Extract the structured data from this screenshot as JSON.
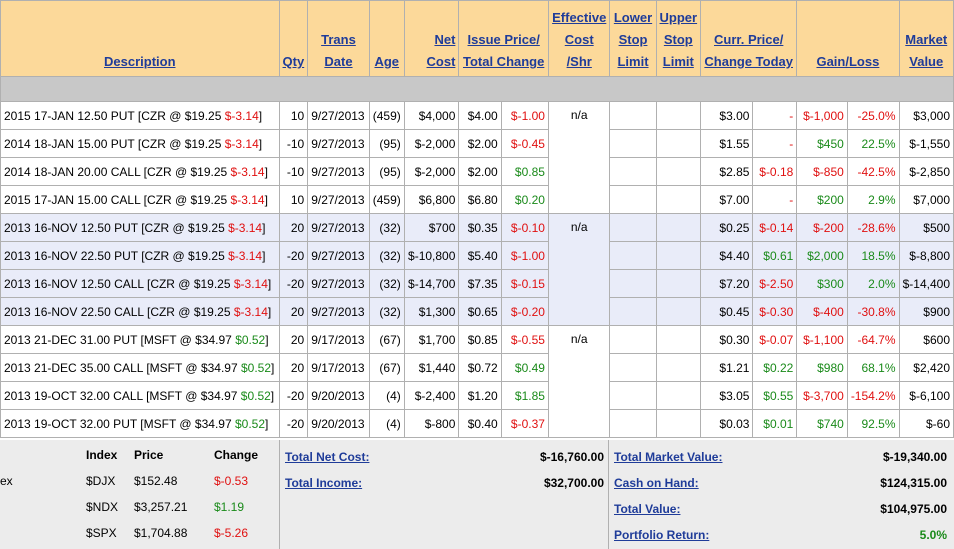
{
  "columns": {
    "description": "Description",
    "qty": "Qty",
    "trans_date": [
      "Trans",
      "Date"
    ],
    "age": "Age",
    "net_cost": [
      "Net",
      "Cost"
    ],
    "issue_price": [
      "Issue Price/",
      "Total Change"
    ],
    "effective_cost": [
      "Effective",
      "Cost",
      "/Shr"
    ],
    "lower_stop": [
      "Lower",
      "Stop",
      "Limit"
    ],
    "upper_stop": [
      "Upper",
      "Stop",
      "Limit"
    ],
    "curr_price": [
      "Curr. Price/",
      "Change Today"
    ],
    "gain_loss": "Gain/Loss",
    "market_value": [
      "Market",
      "Value"
    ]
  },
  "rows": [
    {
      "desc": "2015 17-JAN 12.50 PUT [CZR @ $19.25 ",
      "desc_chg": "$-3.14",
      "desc_end": "]",
      "qty": "10",
      "date": "9/27/2013",
      "age": "(459)",
      "net": "$4,000",
      "issue": "$4.00",
      "tchg": "$-1.00",
      "tchg_s": "neg",
      "eff": "n/a",
      "curr": "$3.00",
      "today": "-",
      "today_s": "neg",
      "gl": "$-1,000",
      "gl_s": "neg",
      "glp": "-25.0%",
      "glp_s": "neg",
      "mv": "$3,000",
      "alt": false
    },
    {
      "desc": "2014 18-JAN 15.00 PUT [CZR @ $19.25 ",
      "desc_chg": "$-3.14",
      "desc_end": "]",
      "qty": "-10",
      "date": "9/27/2013",
      "age": "(95)",
      "net": "$-2,000",
      "issue": "$2.00",
      "tchg": "$-0.45",
      "tchg_s": "neg",
      "eff": "",
      "curr": "$1.55",
      "today": "-",
      "today_s": "neg",
      "gl": "$450",
      "gl_s": "pos",
      "glp": "22.5%",
      "glp_s": "pos",
      "mv": "$-1,550",
      "alt": false
    },
    {
      "desc": "2014 18-JAN 20.00 CALL [CZR @ $19.25 ",
      "desc_chg": "$-3.14",
      "desc_end": "]",
      "qty": "-10",
      "date": "9/27/2013",
      "age": "(95)",
      "net": "$-2,000",
      "issue": "$2.00",
      "tchg": "$0.85",
      "tchg_s": "pos",
      "eff": "",
      "curr": "$2.85",
      "today": "$-0.18",
      "today_s": "neg",
      "gl": "$-850",
      "gl_s": "neg",
      "glp": "-42.5%",
      "glp_s": "neg",
      "mv": "$-2,850",
      "alt": false
    },
    {
      "desc": "2015 17-JAN 15.00 CALL [CZR @ $19.25 ",
      "desc_chg": "$-3.14",
      "desc_end": "]",
      "qty": "10",
      "date": "9/27/2013",
      "age": "(459)",
      "net": "$6,800",
      "issue": "$6.80",
      "tchg": "$0.20",
      "tchg_s": "pos",
      "eff": "",
      "curr": "$7.00",
      "today": "-",
      "today_s": "neg",
      "gl": "$200",
      "gl_s": "pos",
      "glp": "2.9%",
      "glp_s": "pos",
      "mv": "$7,000",
      "alt": false
    },
    {
      "desc": "2013 16-NOV 12.50 PUT [CZR @ $19.25 ",
      "desc_chg": "$-3.14",
      "desc_end": "]",
      "qty": "20",
      "date": "9/27/2013",
      "age": "(32)",
      "net": "$700",
      "issue": "$0.35",
      "tchg": "$-0.10",
      "tchg_s": "neg",
      "eff": "n/a",
      "curr": "$0.25",
      "today": "$-0.14",
      "today_s": "neg",
      "gl": "$-200",
      "gl_s": "neg",
      "glp": "-28.6%",
      "glp_s": "neg",
      "mv": "$500",
      "alt": true
    },
    {
      "desc": "2013 16-NOV 22.50 PUT [CZR @ $19.25 ",
      "desc_chg": "$-3.14",
      "desc_end": "]",
      "qty": "-20",
      "date": "9/27/2013",
      "age": "(32)",
      "net": "$-10,800",
      "issue": "$5.40",
      "tchg": "$-1.00",
      "tchg_s": "neg",
      "eff": "",
      "curr": "$4.40",
      "today": "$0.61",
      "today_s": "pos",
      "gl": "$2,000",
      "gl_s": "pos",
      "glp": "18.5%",
      "glp_s": "pos",
      "mv": "$-8,800",
      "alt": true
    },
    {
      "desc": "2013 16-NOV 12.50 CALL [CZR @ $19.25 ",
      "desc_chg": "$-3.14",
      "desc_end": "]",
      "qty": "-20",
      "date": "9/27/2013",
      "age": "(32)",
      "net": "$-14,700",
      "issue": "$7.35",
      "tchg": "$-0.15",
      "tchg_s": "neg",
      "eff": "",
      "curr": "$7.20",
      "today": "$-2.50",
      "today_s": "neg",
      "gl": "$300",
      "gl_s": "pos",
      "glp": "2.0%",
      "glp_s": "pos",
      "mv": "$-14,400",
      "alt": true
    },
    {
      "desc": "2013 16-NOV 22.50 CALL [CZR @ $19.25 ",
      "desc_chg": "$-3.14",
      "desc_end": "]",
      "qty": "20",
      "date": "9/27/2013",
      "age": "(32)",
      "net": "$1,300",
      "issue": "$0.65",
      "tchg": "$-0.20",
      "tchg_s": "neg",
      "eff": "",
      "curr": "$0.45",
      "today": "$-0.30",
      "today_s": "neg",
      "gl": "$-400",
      "gl_s": "neg",
      "glp": "-30.8%",
      "glp_s": "neg",
      "mv": "$900",
      "alt": true
    },
    {
      "desc": "2013 21-DEC 31.00 PUT [MSFT @ $34.97 ",
      "desc_chg": "$0.52",
      "desc_end": "]",
      "qty": "20",
      "date": "9/17/2013",
      "age": "(67)",
      "net": "$1,700",
      "issue": "$0.85",
      "tchg": "$-0.55",
      "tchg_s": "neg",
      "eff": "n/a",
      "curr": "$0.30",
      "today": "$-0.07",
      "today_s": "neg",
      "gl": "$-1,100",
      "gl_s": "neg",
      "glp": "-64.7%",
      "glp_s": "neg",
      "mv": "$600",
      "alt": false
    },
    {
      "desc": "2013 21-DEC 35.00 CALL [MSFT @ $34.97 ",
      "desc_chg": "$0.52",
      "desc_end": "]",
      "qty": "20",
      "date": "9/17/2013",
      "age": "(67)",
      "net": "$1,440",
      "issue": "$0.72",
      "tchg": "$0.49",
      "tchg_s": "pos",
      "eff": "",
      "curr": "$1.21",
      "today": "$0.22",
      "today_s": "pos",
      "gl": "$980",
      "gl_s": "pos",
      "glp": "68.1%",
      "glp_s": "pos",
      "mv": "$2,420",
      "alt": false
    },
    {
      "desc": "2013 19-OCT 32.00 CALL [MSFT @ $34.97 ",
      "desc_chg": "$0.52",
      "desc_end": "]",
      "qty": "-20",
      "date": "9/20/2013",
      "age": "(4)",
      "net": "$-2,400",
      "issue": "$1.20",
      "tchg": "$1.85",
      "tchg_s": "pos",
      "eff": "",
      "curr": "$3.05",
      "today": "$0.55",
      "today_s": "pos",
      "gl": "$-3,700",
      "gl_s": "neg",
      "glp": "-154.2%",
      "glp_s": "neg",
      "mv": "$-6,100",
      "alt": false
    },
    {
      "desc": "2013 19-OCT 32.00 PUT [MSFT @ $34.97 ",
      "desc_chg": "$0.52",
      "desc_end": "]",
      "qty": "-20",
      "date": "9/20/2013",
      "age": "(4)",
      "net": "$-800",
      "issue": "$0.40",
      "tchg": "$-0.37",
      "tchg_s": "neg",
      "eff": "",
      "curr": "$0.03",
      "today": "$0.01",
      "today_s": "pos",
      "gl": "$740",
      "gl_s": "pos",
      "glp": "92.5%",
      "glp_s": "pos",
      "mv": "$-60",
      "alt": false
    }
  ],
  "index": {
    "cut_label": "ex",
    "headers": {
      "index": "Index",
      "price": "Price",
      "change": "Change"
    },
    "items": [
      {
        "name": "$DJX",
        "price": "$152.48",
        "change": "$-0.53",
        "s": "neg"
      },
      {
        "name": "$NDX",
        "price": "$3,257.21",
        "change": "$1.19",
        "s": "pos"
      },
      {
        "name": "$SPX",
        "price": "$1,704.88",
        "change": "$-5.26",
        "s": "neg"
      }
    ]
  },
  "totals": {
    "net_cost_label": "Total Net Cost:",
    "net_cost": "$-16,760.00",
    "income_label": "Total Income:",
    "income": "$32,700.00",
    "market_value_label": "Total Market Value:",
    "market_value": "$-19,340.00",
    "cash_label": "Cash on Hand:",
    "cash": "$124,315.00",
    "value_label": "Total Value:",
    "value": "$104,975.00",
    "return_label": "Portfolio Return:",
    "return": "5.0%"
  },
  "colors": {
    "negative": "#e01010",
    "positive": "#1a8a1a",
    "header_bg": "#fcd99a",
    "link": "#1f3c99"
  }
}
